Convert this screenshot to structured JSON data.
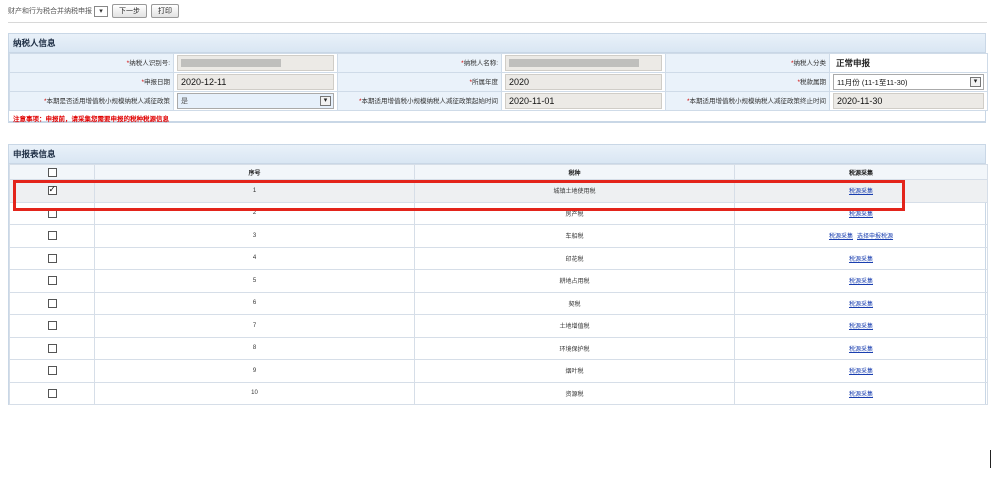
{
  "toolbar": {
    "report_select": "财产和行为税合并纳税申报",
    "dropdown_glyph": "▾",
    "next_label": "下一步",
    "print_label": "打印"
  },
  "taxpayer": {
    "section_title": "纳税人信息",
    "id_label": "纳税人识别号:",
    "name_label": "纳税人名称:",
    "category_label": "纳税人分类",
    "category_value": "正常申报",
    "report_date_label": "申报日期",
    "report_date_value": "2020-12-11",
    "year_label": "所属年度",
    "year_value": "2020",
    "period_label": "税款属期",
    "period_value": "11月份 (11-1至11-30)",
    "reduce_flag_label": "本期是否适用增值税小规模纳税人减征政策",
    "reduce_flag_value": "是",
    "reduce_start_label": "本期适用增值税小规模纳税人减征政策起始时间",
    "reduce_start_value": "2020-11-01",
    "reduce_end_label": "本期适用增值税小规模纳税人减征政策终止时间",
    "reduce_end_value": "2020-11-30",
    "required_mark": "*",
    "notice": "注意事项：申报前，请采集您需要申报的税种税源信息"
  },
  "form": {
    "section_title": "申报表信息",
    "columns": {
      "index": "序号",
      "tax": "税种",
      "source": "税源采集"
    },
    "rows": [
      {
        "index": "1",
        "tax": "城镇土地使用税",
        "links": [
          "税源采集"
        ],
        "checked": true
      },
      {
        "index": "2",
        "tax": "房产税",
        "links": [
          "税源采集"
        ],
        "checked": false
      },
      {
        "index": "3",
        "tax": "车船税",
        "links": [
          "税源采集",
          "选择申报税源"
        ],
        "checked": false
      },
      {
        "index": "4",
        "tax": "印花税",
        "links": [
          "税源采集"
        ],
        "checked": false
      },
      {
        "index": "5",
        "tax": "耕地占用税",
        "links": [
          "税源采集"
        ],
        "checked": false
      },
      {
        "index": "6",
        "tax": "契税",
        "links": [
          "税源采集"
        ],
        "checked": false
      },
      {
        "index": "7",
        "tax": "土地增值税",
        "links": [
          "税源采集"
        ],
        "checked": false
      },
      {
        "index": "8",
        "tax": "环境保护税",
        "links": [
          "税源采集"
        ],
        "checked": false
      },
      {
        "index": "9",
        "tax": "烟叶税",
        "links": [
          "税源采集"
        ],
        "checked": false
      },
      {
        "index": "10",
        "tax": "资源税",
        "links": [
          "税源采集"
        ],
        "checked": false
      }
    ]
  },
  "colors": {
    "highlight": "#e3241b",
    "link": "#1a3fb0",
    "notice": "#e00000",
    "header_bg": "#d9e6f3"
  }
}
